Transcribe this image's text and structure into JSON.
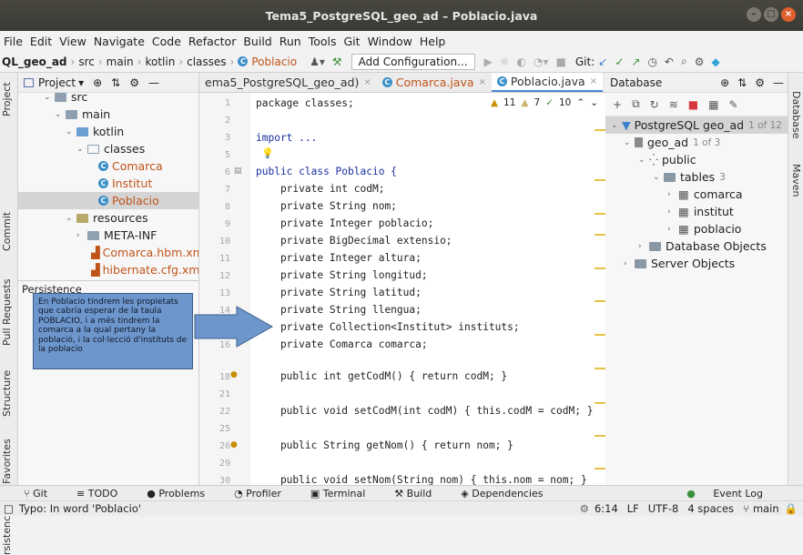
{
  "window": {
    "title": "Tema5_PostgreSQL_geo_ad – Poblacio.java"
  },
  "menu": [
    "File",
    "Edit",
    "View",
    "Navigate",
    "Code",
    "Refactor",
    "Build",
    "Run",
    "Tools",
    "Git",
    "Window",
    "Help"
  ],
  "nav": {
    "crumbs": [
      "QL_geo_ad",
      "src",
      "main",
      "kotlin",
      "classes",
      "Poblacio"
    ],
    "add_config": "Add Configuration...",
    "git_label": "Git:"
  },
  "left_strip": [
    "Project",
    "Commit",
    "Pull Requests",
    "Structure",
    "Favorites",
    "rsistence"
  ],
  "right_strip": [
    "Database",
    "Maven"
  ],
  "project": {
    "header": "Project",
    "rows": [
      "src",
      "main",
      "kotlin",
      "classes",
      "Comarca",
      "Institut",
      "Poblacio",
      "resources",
      "META-INF",
      "Comarca.hbm.xm",
      "hibernate.cfg.xml"
    ],
    "persistence_header": "Persistence"
  },
  "callout": {
    "text": "En Poblacio tindrem les propietats que cabria esperar de la taula POBLACIO, i a més tindrem la comarca a la qual pertany la població, i la col·lecció d'instituts de la poblacio"
  },
  "tabs": [
    "ema5_PostgreSQL_geo_ad)",
    "Comarca.java",
    "Poblacio.java"
  ],
  "inspections": {
    "warnings": "11",
    "weak": "7",
    "typos": "10"
  },
  "editor": {
    "line_numbers": [
      "1",
      "2",
      "3",
      "5",
      "6",
      "7",
      "8",
      "9",
      "10",
      "11",
      "12",
      "13",
      "14",
      "15",
      "16",
      "18",
      "21",
      "22",
      "25",
      "26",
      "29",
      "30"
    ],
    "lines": [
      "package classes;",
      "import ...",
      "public class Poblacio {",
      "    private int codM;",
      "    private String nom;",
      "    private Integer poblacio;",
      "    private BigDecimal extensio;",
      "    private Integer altura;",
      "    private String longitud;",
      "    private String latitud;",
      "    private String llengua;",
      "    private Collection<Institut> instituts;",
      "    private Comarca comarca;",
      "    public int getCodM() { return codM; }",
      "    public void setCodM(int codM) { this.codM = codM; }",
      "    public String getNom() { return nom; }",
      "    public void setNom(String nom) { this.nom = nom; }"
    ]
  },
  "database": {
    "header": "Database",
    "rows": [
      {
        "label": "PostgreSQL geo_ad",
        "extra": "1 of 12"
      },
      {
        "label": "geo_ad",
        "extra": "1 of 3"
      },
      {
        "label": "public",
        "extra": ""
      },
      {
        "label": "tables",
        "extra": "3"
      },
      {
        "label": "comarca",
        "extra": ""
      },
      {
        "label": "institut",
        "extra": ""
      },
      {
        "label": "poblacio",
        "extra": ""
      },
      {
        "label": "Database Objects",
        "extra": ""
      },
      {
        "label": "Server Objects",
        "extra": ""
      }
    ]
  },
  "toolwindows": [
    "Git",
    "TODO",
    "Problems",
    "Profiler",
    "Terminal",
    "Build",
    "Dependencies"
  ],
  "event_log": "Event Log",
  "status": {
    "message": "Typo: In word 'Poblacio'",
    "position": "6:14",
    "line_sep": "LF",
    "encoding": "UTF-8",
    "indent": "4 spaces",
    "branch": "main"
  }
}
